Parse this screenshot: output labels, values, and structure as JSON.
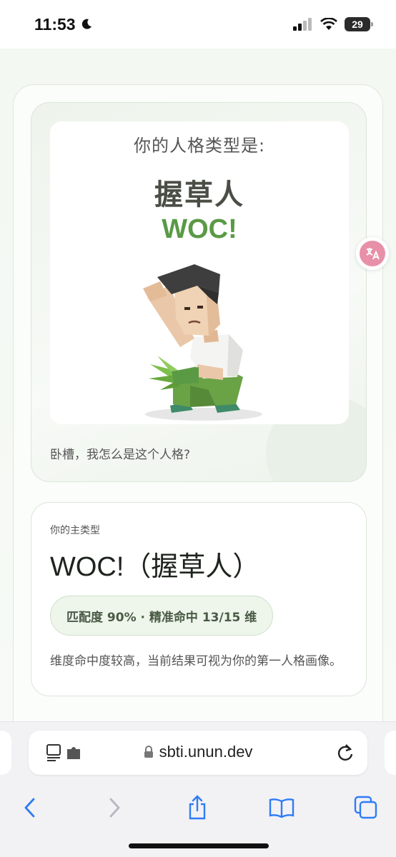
{
  "status_bar": {
    "time": "11:53",
    "battery": "29"
  },
  "hero": {
    "label": "你的人格类型是:",
    "type_cn": "握草人",
    "type_en": "WOC!",
    "caption": "卧槽，我怎么是这个人格?"
  },
  "main_type": {
    "label": "你的主类型",
    "title": "WOC!（握草人）",
    "match_badge": "匹配度 90% · 精准命中 13/15 维",
    "description": "维度命中度较高，当前结果可视为你的第一人格画像。"
  },
  "browser": {
    "url": "sbti.unun.dev",
    "accent_color": "#2f7cf6"
  },
  "colors": {
    "type_en": "#5a9a45",
    "translate_button": "#e790a8"
  }
}
